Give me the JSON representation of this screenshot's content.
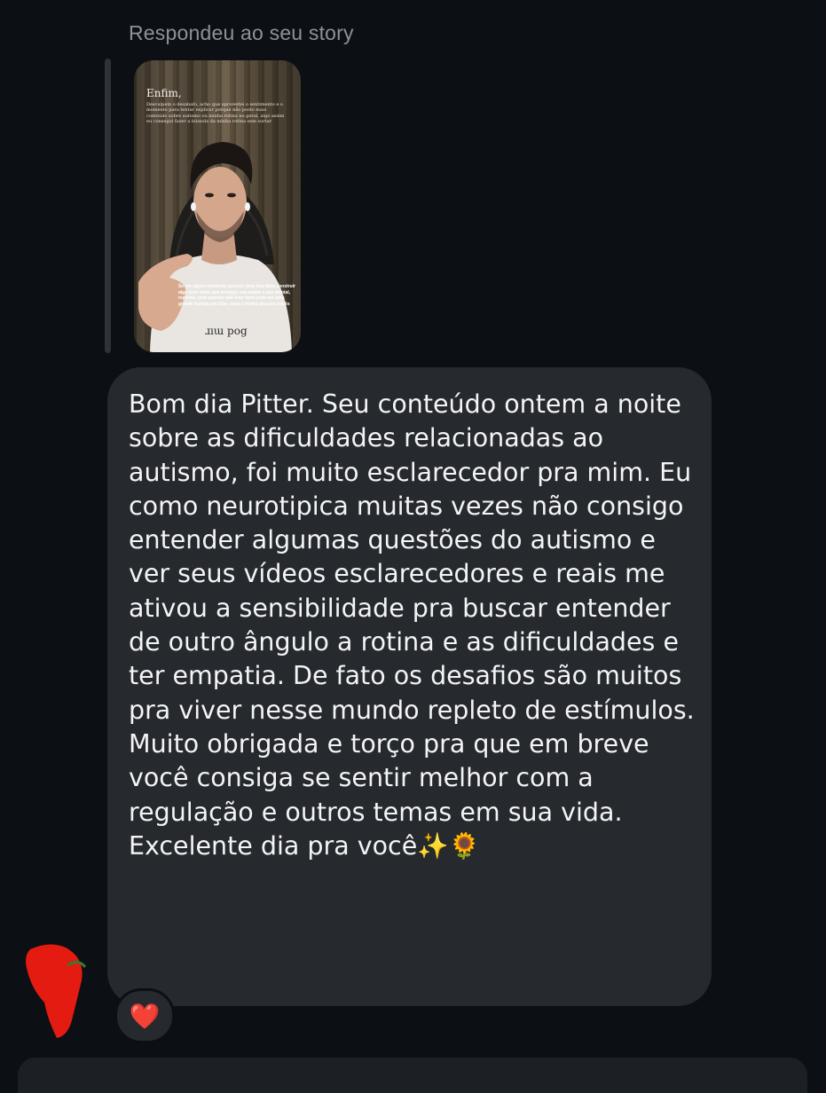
{
  "reply": {
    "label": "Respondeu ao seu story"
  },
  "story": {
    "title": "Enfim,",
    "caption_top": "Desculpem o desabafo, acho que aproveitei o sentimento e o momento para tentar explicar porque não posto mais conteúdo sobre autismo ou minha rotina no geral, algo assim eu consegui fazer a bússola da minha rotina sem surtar",
    "caption_bottom": "Se em algum momento parecer uma boa ideia construir algo num ritmo que arrisque sua saúde e paz mental, repense, pois quando não tiver bem pode ser uma grande bomba pra lidar, essa é minha dica pra vocês",
    "shirt_text": "ɹıɯ pog"
  },
  "message": {
    "text": "Bom dia Pitter. Seu conteúdo ontem a noite sobre as dificuldades relacionadas ao autismo, foi muito esclarecedor pra mim. Eu como neurotipica muitas vezes não consigo entender algumas questões do autismo e ver seus vídeos esclarecedores e reais me ativou a sensibilidade pra buscar entender de outro ângulo a rotina e as dificuldades e ter empatia. De fato os desafios são muitos pra viver nesse mundo repleto de estímulos. Muito obrigada e torço pra que em breve você consiga se sentir melhor com a regulação e outros temas em sua vida. Excelente dia pra você✨🌻"
  },
  "reaction": {
    "icon": "heart-icon",
    "glyph": "❤️",
    "color": "#f23b4b"
  },
  "colors": {
    "background": "#0c0f13",
    "bubble": "#26292e",
    "label": "#8e9298",
    "redaction": "#e41b10"
  }
}
